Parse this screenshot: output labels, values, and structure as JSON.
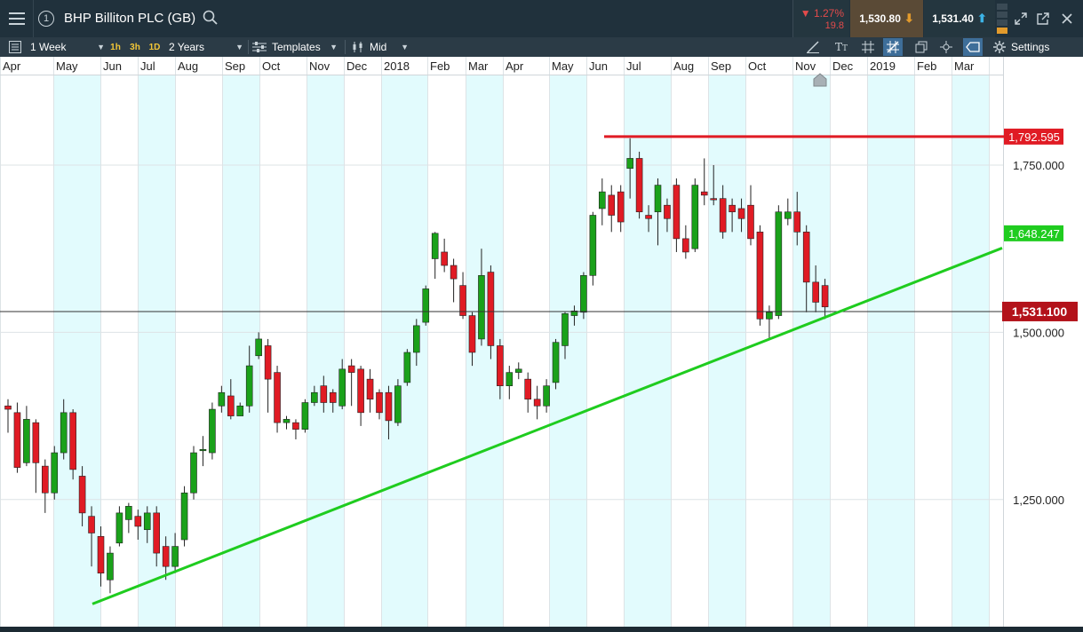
{
  "window": {
    "instrument": "BHP Billiton PLC (GB)",
    "info_badge": "1",
    "change_pct": "▼ 1.27%",
    "change_abs": "19.8",
    "sell_price": "1,530.80",
    "buy_price": "1,531.40"
  },
  "toolbar": {
    "period": "1 Week",
    "quick_1h": "1h",
    "quick_3h": "3h",
    "quick_1d": "1D",
    "range": "2 Years",
    "templates": "Templates",
    "price_type": "Mid",
    "settings": "Settings"
  },
  "colors": {
    "up": "#1aa11a",
    "down": "#e01b24",
    "trendline": "#1fcc1f",
    "resistance": "#e01b24",
    "shade": "#e2fbfd"
  },
  "chart_data": {
    "type": "candlestick",
    "x_tick_labels": [
      "Apr",
      "May",
      "Jun",
      "Jul",
      "Aug",
      "Sep",
      "Oct",
      "Nov",
      "Dec",
      "2018",
      "Feb",
      "Mar",
      "Apr",
      "May",
      "Jun",
      "Jul",
      "Aug",
      "Sep",
      "Oct",
      "Nov",
      "Dec",
      "2019",
      "Feb",
      "Mar"
    ],
    "y_tick_labels": [
      "1,750.000",
      "1,500.000",
      "1,250.000"
    ],
    "y_ticks": [
      1750,
      1500,
      1250
    ],
    "ylim": [
      1060,
      1880
    ],
    "price_labels": {
      "resistance": "1,792.595",
      "trendline_end": "1,648.247",
      "current": "1,531.100"
    },
    "levels": {
      "resistance": 1792.595,
      "current": 1531.1
    },
    "trendline": {
      "start": {
        "date": "2017-05",
        "price": 1094
      },
      "end": {
        "date": "2019-03",
        "price": 1626
      }
    },
    "candles": [
      [
        1390,
        1385,
        1350,
        1400
      ],
      [
        1380,
        1298,
        1290,
        1395
      ],
      [
        1305,
        1370,
        1300,
        1390
      ],
      [
        1365,
        1305,
        1260,
        1370
      ],
      [
        1300,
        1260,
        1230,
        1310
      ],
      [
        1260,
        1320,
        1250,
        1330
      ],
      [
        1320,
        1380,
        1310,
        1400
      ],
      [
        1380,
        1295,
        1280,
        1385
      ],
      [
        1285,
        1230,
        1210,
        1300
      ],
      [
        1225,
        1200,
        1150,
        1240
      ],
      [
        1195,
        1140,
        1120,
        1210
      ],
      [
        1130,
        1170,
        1110,
        1180
      ],
      [
        1185,
        1230,
        1180,
        1240
      ],
      [
        1220,
        1240,
        1200,
        1245
      ],
      [
        1225,
        1210,
        1190,
        1235
      ],
      [
        1205,
        1230,
        1185,
        1240
      ],
      [
        1230,
        1170,
        1150,
        1240
      ],
      [
        1180,
        1150,
        1130,
        1195
      ],
      [
        1150,
        1180,
        1140,
        1200
      ],
      [
        1190,
        1260,
        1180,
        1270
      ],
      [
        1260,
        1320,
        1250,
        1330
      ],
      [
        1325,
        1325,
        1300,
        1345
      ],
      [
        1320,
        1385,
        1310,
        1395
      ],
      [
        1390,
        1410,
        1380,
        1420
      ],
      [
        1405,
        1375,
        1370,
        1430
      ],
      [
        1375,
        1390,
        1375,
        1395
      ],
      [
        1390,
        1450,
        1380,
        1480
      ],
      [
        1465,
        1490,
        1460,
        1500
      ],
      [
        1480,
        1430,
        1380,
        1490
      ],
      [
        1440,
        1365,
        1350,
        1450
      ],
      [
        1365,
        1370,
        1355,
        1375
      ],
      [
        1365,
        1355,
        1340,
        1370
      ],
      [
        1355,
        1395,
        1350,
        1400
      ],
      [
        1395,
        1410,
        1390,
        1420
      ],
      [
        1420,
        1395,
        1380,
        1435
      ],
      [
        1410,
        1395,
        1380,
        1415
      ],
      [
        1390,
        1445,
        1385,
        1460
      ],
      [
        1450,
        1440,
        1390,
        1460
      ],
      [
        1445,
        1380,
        1360,
        1450
      ],
      [
        1430,
        1400,
        1380,
        1445
      ],
      [
        1410,
        1380,
        1370,
        1415
      ],
      [
        1410,
        1368,
        1340,
        1420
      ],
      [
        1365,
        1420,
        1360,
        1430
      ],
      [
        1425,
        1470,
        1420,
        1475
      ],
      [
        1470,
        1510,
        1450,
        1520
      ],
      [
        1515,
        1565,
        1510,
        1570
      ],
      [
        1610,
        1648,
        1580,
        1650
      ],
      [
        1620,
        1600,
        1590,
        1640
      ],
      [
        1600,
        1580,
        1545,
        1610
      ],
      [
        1570,
        1525,
        1520,
        1590
      ],
      [
        1525,
        1470,
        1450,
        1530
      ],
      [
        1490,
        1585,
        1480,
        1625
      ],
      [
        1590,
        1480,
        1460,
        1600
      ],
      [
        1480,
        1420,
        1400,
        1490
      ],
      [
        1420,
        1440,
        1400,
        1450
      ],
      [
        1440,
        1445,
        1430,
        1455
      ],
      [
        1430,
        1400,
        1380,
        1440
      ],
      [
        1400,
        1390,
        1370,
        1420
      ],
      [
        1390,
        1420,
        1380,
        1430
      ],
      [
        1425,
        1485,
        1415,
        1490
      ],
      [
        1480,
        1528,
        1460,
        1530
      ],
      [
        1525,
        1532,
        1510,
        1540
      ],
      [
        1530,
        1585,
        1520,
        1590
      ],
      [
        1585,
        1675,
        1570,
        1680
      ],
      [
        1685,
        1710,
        1660,
        1730
      ],
      [
        1705,
        1675,
        1650,
        1720
      ],
      [
        1710,
        1665,
        1650,
        1720
      ],
      [
        1745,
        1760,
        1700,
        1790
      ],
      [
        1760,
        1680,
        1670,
        1770
      ],
      [
        1675,
        1670,
        1650,
        1690
      ],
      [
        1680,
        1720,
        1630,
        1730
      ],
      [
        1690,
        1670,
        1650,
        1700
      ],
      [
        1720,
        1640,
        1620,
        1730
      ],
      [
        1640,
        1620,
        1610,
        1660
      ],
      [
        1625,
        1720,
        1620,
        1730
      ],
      [
        1710,
        1705,
        1690,
        1760
      ],
      [
        1700,
        1698,
        1690,
        1750
      ],
      [
        1700,
        1650,
        1640,
        1720
      ],
      [
        1690,
        1680,
        1650,
        1700
      ],
      [
        1685,
        1670,
        1650,
        1700
      ],
      [
        1690,
        1640,
        1630,
        1720
      ],
      [
        1650,
        1520,
        1510,
        1660
      ],
      [
        1520,
        1530,
        1490,
        1540
      ],
      [
        1525,
        1680,
        1520,
        1690
      ],
      [
        1670,
        1680,
        1660,
        1700
      ],
      [
        1680,
        1650,
        1630,
        1710
      ],
      [
        1650,
        1575,
        1530,
        1660
      ],
      [
        1575,
        1545,
        1530,
        1600
      ],
      [
        1570,
        1538,
        1520,
        1580
      ]
    ]
  }
}
